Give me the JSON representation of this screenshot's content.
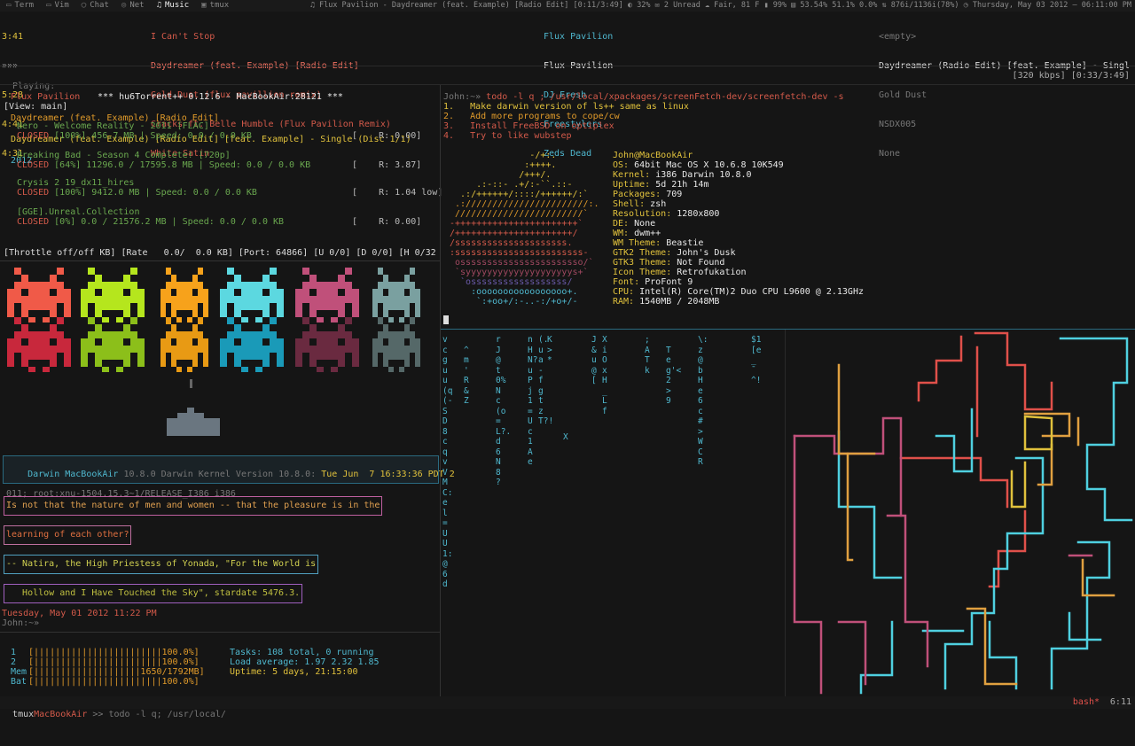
{
  "topbar": {
    "tabs": [
      {
        "icon": "terminal-icon",
        "glyph": "▭",
        "label": "Term"
      },
      {
        "icon": "vim-icon",
        "glyph": "▭",
        "label": "Vim"
      },
      {
        "icon": "chat-icon",
        "glyph": "◯",
        "label": "Chat"
      },
      {
        "icon": "net-icon",
        "glyph": "◎",
        "label": "Net"
      },
      {
        "icon": "music-icon",
        "glyph": "♫",
        "label": "Music"
      },
      {
        "icon": "tmux-icon",
        "glyph": "▣",
        "label": "tmux"
      }
    ],
    "status": "♫ Flux Pavilion - Daydreamer (feat. Example) [Radio Edit] [0:11/3:49]  ◐ 32%  ✉ 2 Unread  ☁ Fair, 81 F  ▮ 99%  ▤ 53.54%  51.1%  0.0%  ⇅ 876i/1136i(78%)  ◷ Thursday, May 03 2012 — 06:11:00 PM"
  },
  "cmus": {
    "times": [
      "3:41",
      "»»»",
      "5:28",
      "4:41",
      "4:31"
    ],
    "titles": [
      "I Can't Stop",
      "Daydreamer (feat. Example) [Radio Edit]",
      "Gold Dust (flux pavillion remix)",
      "Cracks ft. Belle Humble (Flux Pavilion Remix)",
      "White Satin"
    ],
    "artists": [
      "Flux Pavilion",
      "Flux Pavilion",
      "DJ Fresh",
      "Freestylers",
      "Zeds Dead"
    ],
    "albums": [
      "<empty>",
      "Daydreamer (Radio Edit) [feat. Example] - Singl",
      "Gold Dust",
      "NSDX005",
      "None"
    ],
    "playing_label": "Playing:",
    "playing_artist": "Flux Pavilion",
    "playing_title": "Daydreamer (feat. Example) [Radio Edit]",
    "playing_album": "Daydreamer (feat. Example) [Radio Edit] [feat. Example] - Single (Disc 1/1)",
    "playing_year": "2012",
    "bitrate": "[320 kbps] [0:33/3:49]"
  },
  "torrent": {
    "header": "*** hu6Torrent++ 0.12.6 - MacBookAir:28121 ***",
    "view": "[View: main]",
    "items": [
      {
        "name": "Nero - Welcome Reality - 2011 [FLAC]",
        "status": "CLOSED",
        "detail": "[100%] 456.7 MB | Speed: 0.0 / 0.0 KB",
        "ratio": "[    R: 0.00]"
      },
      {
        "name": "Breaking Bad - Season 4 Complete! [720p]",
        "status": "CLOSED",
        "detail": "[64%] 11296.0 / 17595.8 MB | Speed: 0.0 / 0.0 KB",
        "ratio": "[    R: 3.87]"
      },
      {
        "name": "Crysis 2 19_dx11_hires",
        "status": "CLOSED",
        "detail": "[100%] 9412.0 MB | Speed: 0.0 / 0.0 KB",
        "ratio": "[    R: 1.04 low]"
      },
      {
        "name": "[GGE].Unreal.Collection",
        "status": "CLOSED",
        "detail": "[0%] 0.0 / 21576.2 MB | Speed: 0.0 / 0.0 KB",
        "ratio": "[    R: 0.00]"
      }
    ],
    "footer": "[Throttle off/off KB] [Rate   0.0/  0.0 KB] [Port: 64866] [U 0/0] [D 0/0] [H 0/32"
  },
  "uname": {
    "host": "MacBookAir",
    "line1a": "Darwin ",
    "line1b": " 10.8.0 Darwin Kernel Version 10.8.0: ",
    "line1c": "Tue Jun  7 16:33:36 PDT 2",
    "line2": "011; root:xnu-1504.15.3~1/RELEASE_I386 i386"
  },
  "fortune": [
    "Is not that the nature of men and women -- that the pleasure is in the",
    "learning of each other?",
    "-- Natira, the High Priestess of Yonada, \"For the World is",
    "   Hollow and I Have Touched the Sky\", stardate 5476.3."
  ],
  "date_line": "Tuesday, May 01 2012 11:22 PM",
  "prompt_left": "John:~»",
  "htop": {
    "bars": [
      {
        "label": "1",
        "bar": "[||||||||||||||||||||||||100.0%]"
      },
      {
        "label": "2",
        "bar": "[||||||||||||||||||||||||100.0%]"
      },
      {
        "label": "Mem",
        "bar": "[||||||||||||||||||||1650/1792MB]"
      },
      {
        "label": "Bat",
        "bar": "[||||||||||||||||||||||||100.0%]"
      }
    ],
    "tasks": "Tasks: 108 total, 0 running",
    "load": "Load average: 1.97 2.32 1.85",
    "uptime": "Uptime: 5 days, 21:15:00"
  },
  "right_term": {
    "prompt": "John:~» ",
    "cmd": "todo -l q ; /usr/local/xpackages/screenFetch-dev/screenfetch-dev -s",
    "todos": [
      "1.   Make darwin version of ls++ same as linux",
      "2.   Add more programs to cope/cw",
      "3.   Install FreeBSD on optiplex",
      "4.   Try to like wubstep"
    ],
    "logo": [
      "               -/+:.",
      "              :++++.",
      "             /+++/.",
      "     .:-::- .+/:-``.::-",
      "  .:/++++++/::::/++++++/:`",
      " .:///////////////////////:.",
      " ////////////////////////`",
      "-+++++++++++++++++++++++`",
      "/++++++++++++++++++++++/",
      "/sssssssssssssssssssss.",
      ":ssssssssssssssssssssssss-",
      " osssssssssssssssssssssso/`",
      " `syyyyyyyyyyyyyyyyyyyys+`",
      "  `ossssssssssssssssss/",
      "    :ooooooooooooooooo+.",
      "     `:+oo+/:-..-:/+o+/-"
    ],
    "info_user": "John@MacBookAir",
    "info": [
      [
        "OS:",
        "64bit Mac OS X 10.6.8 10K549"
      ],
      [
        "Kernel:",
        "i386 Darwin 10.8.0"
      ],
      [
        "Uptime:",
        "5d 21h 14m"
      ],
      [
        "Packages:",
        "709"
      ],
      [
        "Shell:",
        "zsh"
      ],
      [
        "Resolution:",
        "1280x800"
      ],
      [
        "DE:",
        "None"
      ],
      [
        "WM:",
        "dwm++"
      ],
      [
        "WM Theme:",
        "Beastie"
      ],
      [
        "GTK2 Theme:",
        "John's Dusk"
      ],
      [
        "GTK3 Theme:",
        "Not Found"
      ],
      [
        "Icon Theme:",
        "Retrofukation"
      ],
      [
        "Font:",
        "ProFont 9"
      ],
      [
        "CPU:",
        "Intel(R) Core(TM)2 Duo CPU L9600 @ 2.13GHz"
      ],
      [
        "RAM:",
        "1540MB / 2048MB"
      ]
    ]
  },
  "matrix_cols": [
    "vcguu(q(-     SD8cqvVMC:el=UU1:@6d",
    "        ^ m ' R&Z",
    "           ",
    "rJ@t0%Nc(o=L?.d6N8    ?",
    "nHN?uPj1=Uc1Ae",
    "(.ua-fgtzT?!",
    "K>*     ",
    "X",
    "J&u@[ ",
    "XiOxH_Lf",
    ";ATk",
    "  Teg'<2>9",
    "\\:z@bHe6c#>WCR",
    "$1[e_¯^!"
  ],
  "tmux": {
    "left": "tmux",
    "host": "MacBookAir",
    "cmd": ">> todo -l q; /usr/local/",
    "right": "bash*",
    "clock": "6:11"
  },
  "colors": {
    "red": "#d45a4a",
    "orange": "#e09a2a",
    "cyan": "#4fb8cf",
    "yellow": "#e0c13c"
  }
}
